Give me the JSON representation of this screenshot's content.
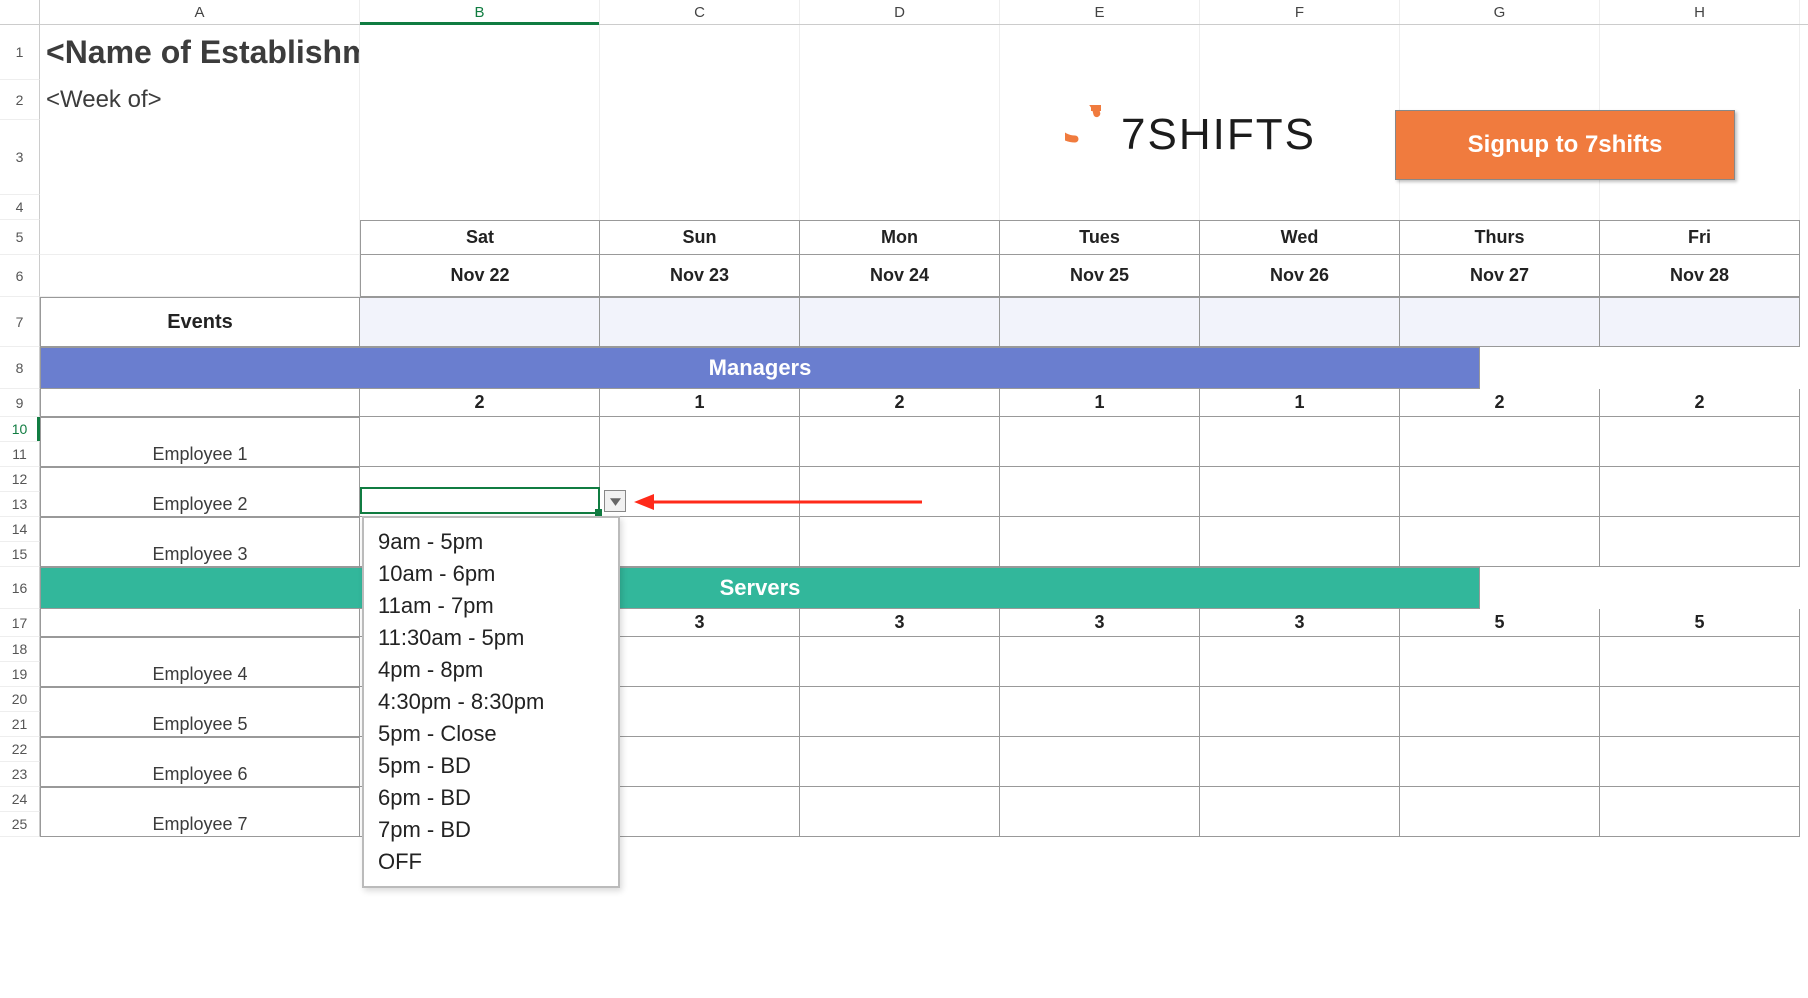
{
  "columns": [
    "A",
    "B",
    "C",
    "D",
    "E",
    "F",
    "G",
    "H"
  ],
  "row_numbers": [
    1,
    2,
    3,
    4,
    5,
    6,
    7,
    8,
    9,
    10,
    11,
    12,
    13,
    14,
    15,
    16,
    17,
    18,
    19,
    20,
    21,
    22,
    23,
    24,
    25
  ],
  "selected_column": "B",
  "selected_row": 10,
  "title": "<Name of Establishment>",
  "subtitle": "<Week of>",
  "logo_text": "7SHIFTS",
  "cta_label": "Signup to 7shifts",
  "days": [
    "Sat",
    "Sun",
    "Mon",
    "Tues",
    "Wed",
    "Thurs",
    "Fri"
  ],
  "dates": [
    "Nov 22",
    "Nov 23",
    "Nov 24",
    "Nov 25",
    "Nov 26",
    "Nov 27",
    "Nov 28"
  ],
  "events_label": "Events",
  "sections": {
    "managers": {
      "label": "Managers",
      "counts": [
        "2",
        "1",
        "2",
        "1",
        "1",
        "2",
        "2"
      ]
    },
    "servers": {
      "label": "Servers",
      "counts": [
        "",
        "3",
        "3",
        "3",
        "3",
        "5",
        "5"
      ]
    }
  },
  "managers_employees": [
    "Employee 1",
    "Employee 2",
    "Employee 3"
  ],
  "servers_employees": [
    "Employee 4",
    "Employee 5",
    "Employee 6",
    "Employee 7"
  ],
  "dropdown_options": [
    "9am - 5pm",
    "10am - 6pm",
    "11am - 7pm",
    "11:30am - 5pm",
    "4pm - 8pm",
    "4:30pm - 8:30pm",
    "5pm - Close",
    "5pm - BD",
    "6pm - BD",
    "7pm - BD",
    "OFF"
  ],
  "colors": {
    "managers_bg": "#6a7ecf",
    "servers_bg": "#32b79b",
    "cta_bg": "#f07b3e",
    "selection": "#107c41",
    "arrow": "#ff2a1a"
  },
  "chart_data": {
    "type": "table",
    "title": "<Name of Establishment> — <Week of>",
    "columns": [
      "Sat Nov 22",
      "Sun Nov 23",
      "Mon Nov 24",
      "Tues Nov 25",
      "Wed Nov 26",
      "Thurs Nov 27",
      "Fri Nov 28"
    ],
    "sections": [
      {
        "name": "Managers",
        "counts": [
          2,
          1,
          2,
          1,
          1,
          2,
          2
        ],
        "rows": [
          "Employee 1",
          "Employee 2",
          "Employee 3"
        ]
      },
      {
        "name": "Servers",
        "counts": [
          null,
          3,
          3,
          3,
          3,
          5,
          5
        ],
        "rows": [
          "Employee 4",
          "Employee 5",
          "Employee 6",
          "Employee 7"
        ]
      }
    ],
    "dropdown_cell": {
      "row": "Employee 1",
      "col": "Sat Nov 22"
    },
    "dropdown_options": [
      "9am - 5pm",
      "10am - 6pm",
      "11am - 7pm",
      "11:30am - 5pm",
      "4pm - 8pm",
      "4:30pm - 8:30pm",
      "5pm - Close",
      "5pm - BD",
      "6pm - BD",
      "7pm - BD",
      "OFF"
    ]
  }
}
